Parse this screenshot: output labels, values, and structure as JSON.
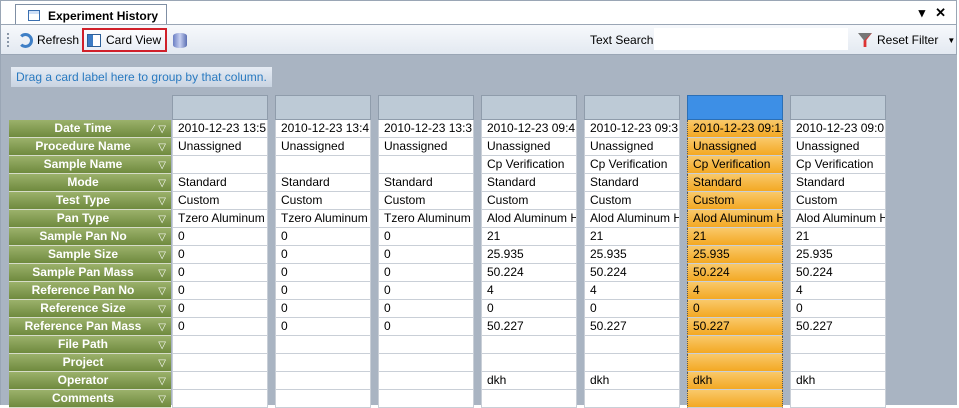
{
  "tab": {
    "title": "Experiment History"
  },
  "window": {
    "pin_glyph": "▾",
    "close_glyph": "✕"
  },
  "toolbar": {
    "refresh_label": "Refresh",
    "cardview_label": "Card View",
    "search_label": "Text Search",
    "search_value": "",
    "reset_label": "Reset Filter"
  },
  "group_hint": "Drag a card label here to group by that column.",
  "labels": [
    "Date Time",
    "Procedure Name",
    "Sample Name",
    "Mode",
    "Test Type",
    "Pan Type",
    "Sample Pan No",
    "Sample Size",
    "Sample Pan Mass",
    "Reference Pan No",
    "Reference Size",
    "Reference Pan Mass",
    "File Path",
    "Project",
    "Operator",
    "Comments"
  ],
  "cards": [
    {
      "Date Time": "2010-12-23 13:5",
      "Procedure Name": "Unassigned",
      "Sample Name": "",
      "Mode": "Standard",
      "Test Type": "Custom",
      "Pan Type": "Tzero Aluminum",
      "Sample Pan No": "0",
      "Sample Size": "0",
      "Sample Pan Mass": "0",
      "Reference Pan No": "0",
      "Reference Size": "0",
      "Reference Pan Mass": "0",
      "File Path": "",
      "Project": "",
      "Operator": "",
      "Comments": ""
    },
    {
      "Date Time": "2010-12-23 13:4",
      "Procedure Name": "Unassigned",
      "Sample Name": "",
      "Mode": "Standard",
      "Test Type": "Custom",
      "Pan Type": "Tzero Aluminum",
      "Sample Pan No": "0",
      "Sample Size": "0",
      "Sample Pan Mass": "0",
      "Reference Pan No": "0",
      "Reference Size": "0",
      "Reference Pan Mass": "0",
      "File Path": "",
      "Project": "",
      "Operator": "",
      "Comments": ""
    },
    {
      "Date Time": "2010-12-23 13:3",
      "Procedure Name": "Unassigned",
      "Sample Name": "",
      "Mode": "Standard",
      "Test Type": "Custom",
      "Pan Type": "Tzero Aluminum",
      "Sample Pan No": "0",
      "Sample Size": "0",
      "Sample Pan Mass": "0",
      "Reference Pan No": "0",
      "Reference Size": "0",
      "Reference Pan Mass": "0",
      "File Path": "",
      "Project": "",
      "Operator": "",
      "Comments": ""
    },
    {
      "Date Time": "2010-12-23 09:4",
      "Procedure Name": "Unassigned",
      "Sample Name": "Cp Verification",
      "Mode": "Standard",
      "Test Type": "Custom",
      "Pan Type": "Alod Aluminum H",
      "Sample Pan No": "21",
      "Sample Size": "25.935",
      "Sample Pan Mass": "50.224",
      "Reference Pan No": "4",
      "Reference Size": "0",
      "Reference Pan Mass": "50.227",
      "File Path": "",
      "Project": "",
      "Operator": "dkh",
      "Comments": ""
    },
    {
      "Date Time": "2010-12-23 09:3",
      "Procedure Name": "Unassigned",
      "Sample Name": "Cp Verification",
      "Mode": "Standard",
      "Test Type": "Custom",
      "Pan Type": "Alod Aluminum H",
      "Sample Pan No": "21",
      "Sample Size": "25.935",
      "Sample Pan Mass": "50.224",
      "Reference Pan No": "4",
      "Reference Size": "0",
      "Reference Pan Mass": "50.227",
      "File Path": "",
      "Project": "",
      "Operator": "dkh",
      "Comments": ""
    },
    {
      "Date Time": "2010-12-23 09:1",
      "Procedure Name": "Unassigned",
      "Sample Name": "Cp Verification",
      "Mode": "Standard",
      "Test Type": "Custom",
      "Pan Type": "Alod Aluminum H",
      "Sample Pan No": "21",
      "Sample Size": "25.935",
      "Sample Pan Mass": "50.224",
      "Reference Pan No": "4",
      "Reference Size": "0",
      "Reference Pan Mass": "50.227",
      "File Path": "",
      "Project": "",
      "Operator": "dkh",
      "Comments": "",
      "selected": true
    },
    {
      "Date Time": "2010-12-23 09:0",
      "Procedure Name": "Unassigned",
      "Sample Name": "Cp Verification",
      "Mode": "Standard",
      "Test Type": "Custom",
      "Pan Type": "Alod Aluminum H",
      "Sample Pan No": "21",
      "Sample Size": "25.935",
      "Sample Pan Mass": "50.224",
      "Reference Pan No": "4",
      "Reference Size": "0",
      "Reference Pan Mass": "50.227",
      "File Path": "",
      "Project": "",
      "Operator": "dkh",
      "Comments": ""
    }
  ],
  "sort": {
    "column": "Date Time",
    "direction": "descending"
  },
  "colors": {
    "accent_selected": "#f3a823",
    "label_green": "#7f9a4c",
    "toolbar_highlight": "#d0202a"
  }
}
